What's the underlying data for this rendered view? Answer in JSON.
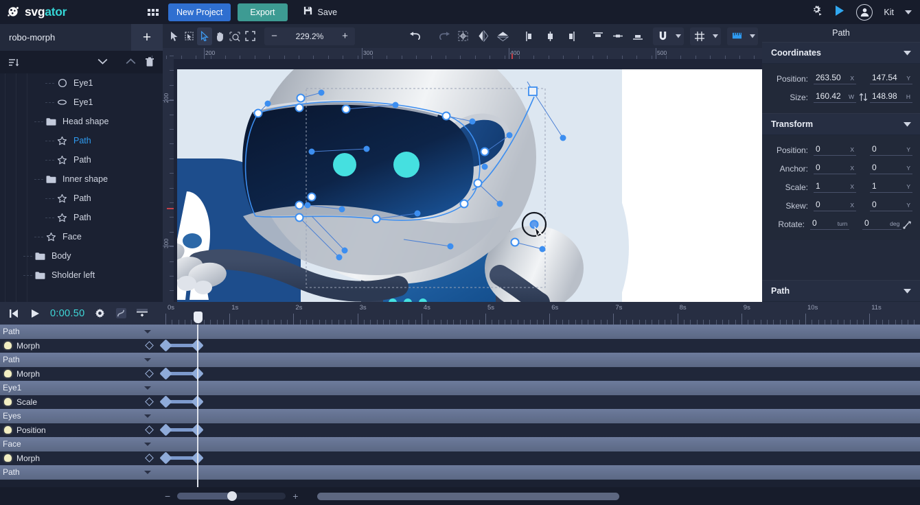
{
  "app": {
    "brand_white": "svg",
    "brand_accent": "ator",
    "accent_color": "#35d6d6"
  },
  "topbar": {
    "apps_icon": "grid-apps-icon",
    "new_project_label": "New Project",
    "export_label": "Export",
    "save_label": "Save",
    "settings_icon": "gear-run-icon",
    "play_icon": "play-icon",
    "user_name": "Kit",
    "user_menu_icon": "chevron-down-icon"
  },
  "left_panel": {
    "project_name": "robo-morph",
    "add_label": "+",
    "tools": {
      "sort_icon": "sort-list-icon",
      "collapse_icon": "chevron-down-icon",
      "expand_icon": "chevron-up-icon",
      "delete_icon": "trash-icon"
    },
    "layers": [
      {
        "label": "Eye1",
        "icon": "circle-shape-icon",
        "depth": 4,
        "type": "shape",
        "selected": false
      },
      {
        "label": "Eye1",
        "icon": "ellipse-shape-icon",
        "depth": 4,
        "type": "shape",
        "selected": false
      },
      {
        "label": "Head shape",
        "icon": "folder-icon",
        "depth": 3,
        "type": "folder",
        "selected": false
      },
      {
        "label": "Path",
        "icon": "path-star-icon",
        "depth": 4,
        "type": "path",
        "selected": true
      },
      {
        "label": "Path",
        "icon": "path-star-icon",
        "depth": 4,
        "type": "path",
        "selected": false
      },
      {
        "label": "Inner shape",
        "icon": "folder-icon",
        "depth": 3,
        "type": "folder",
        "selected": false
      },
      {
        "label": "Path",
        "icon": "path-star-icon",
        "depth": 4,
        "type": "path",
        "selected": false
      },
      {
        "label": "Path",
        "icon": "path-star-icon",
        "depth": 4,
        "type": "path",
        "selected": false
      },
      {
        "label": "Face",
        "icon": "path-star-icon",
        "depth": 3,
        "type": "path",
        "selected": false
      },
      {
        "label": "Body",
        "icon": "folder-icon",
        "depth": 2,
        "type": "folder",
        "selected": false
      },
      {
        "label": "Sholder left",
        "icon": "folder-icon",
        "depth": 2,
        "type": "folder",
        "selected": false
      }
    ]
  },
  "canvas_toolbar": {
    "tools": [
      {
        "name": "select-arrow-tool",
        "active": false
      },
      {
        "name": "transform-box-tool",
        "active": false
      },
      {
        "name": "node-edit-tool",
        "active": true
      },
      {
        "name": "hand-pan-tool",
        "active": false
      },
      {
        "name": "zoom-tool",
        "active": false
      },
      {
        "name": "fit-screen-tool",
        "active": false
      }
    ],
    "zoom_minus": "−",
    "zoom_value": "229.2%",
    "zoom_plus": "+",
    "undo_icon": "undo-arrow-icon",
    "redo_icon": "redo-arrow-icon",
    "align_tools": [
      "anchor-center-icon",
      "flip-horizontal-icon",
      "flip-vertical-icon",
      "align-left-icon",
      "align-center-h-icon",
      "align-right-icon",
      "align-top-icon",
      "align-middle-v-icon",
      "align-bottom-icon"
    ],
    "snap_icon": "magnet-snap-icon",
    "grid_icon": "grid-icon",
    "ruler_icon": "ruler-icon",
    "dropdown_icon": "caret-down-icon"
  },
  "canvas": {
    "ruler_h_labels": [
      "200",
      "300",
      "400",
      "500"
    ],
    "ruler_v_labels": [
      "200",
      "300"
    ],
    "cursor_icon": "pen-node-cursor"
  },
  "right_panel": {
    "title": "Path",
    "sections": [
      {
        "title": "Coordinates",
        "collapse_icon": "caret-down-icon"
      },
      {
        "title": "Transform",
        "collapse_icon": "caret-down-icon"
      },
      {
        "title": "Path",
        "collapse_icon": "caret-down-icon"
      }
    ],
    "coordinates": {
      "position_label": "Position:",
      "position_x": "263.50",
      "position_x_unit": "X",
      "position_y": "147.54",
      "position_y_unit": "Y",
      "size_label": "Size:",
      "size_w": "160.42",
      "size_w_unit": "W",
      "size_h": "148.98",
      "size_h_unit": "H",
      "link_icon": "link-ratio-icon"
    },
    "transform": {
      "rows": [
        {
          "label": "Position:",
          "x": "0",
          "xu": "X",
          "y": "0",
          "yu": "Y"
        },
        {
          "label": "Anchor:",
          "x": "0",
          "xu": "X",
          "y": "0",
          "yu": "Y"
        },
        {
          "label": "Scale:",
          "x": "1",
          "xu": "X",
          "y": "1",
          "yu": "Y"
        },
        {
          "label": "Skew:",
          "x": "0",
          "xu": "X",
          "y": "0",
          "yu": "Y"
        },
        {
          "label": "Rotate:",
          "x": "0",
          "xu": "turn",
          "y": "0",
          "yu": "deg",
          "extra_icon": "rotate-handle-icon"
        }
      ]
    }
  },
  "timeline": {
    "controls": {
      "skip_start_icon": "skip-to-start-icon",
      "play_icon": "play-icon",
      "current_time": "0:00.50",
      "settings_icon": "gear-icon",
      "easing_icon": "easing-curve-icon",
      "keyframe_panel_icon": "keyframe-editor-icon"
    },
    "ruler_labels": [
      "0s",
      "1s",
      "2s",
      "3s",
      "4s",
      "5s",
      "6s",
      "7s",
      "8s",
      "9s",
      "10s",
      "11s"
    ],
    "playhead_time_s": 0.5,
    "tracks": [
      {
        "type": "group",
        "label": "Path",
        "caret_icon": "caret-down-icon"
      },
      {
        "type": "prop",
        "label": "Morph",
        "bulb_icon": "bulb-icon",
        "kf_icon": "keyframe-diamond-icon",
        "keyframes": [
          0,
          0.5
        ]
      },
      {
        "type": "group",
        "label": "Path",
        "caret_icon": "caret-down-icon"
      },
      {
        "type": "prop",
        "label": "Morph",
        "bulb_icon": "bulb-icon",
        "kf_icon": "keyframe-diamond-icon",
        "keyframes": [
          0,
          0.5
        ]
      },
      {
        "type": "group",
        "label": "Eye1",
        "caret_icon": "caret-down-icon"
      },
      {
        "type": "prop",
        "label": "Scale",
        "bulb_icon": "bulb-icon",
        "kf_icon": "keyframe-diamond-icon",
        "keyframes": [
          0,
          0.5
        ]
      },
      {
        "type": "group",
        "label": "Eyes",
        "caret_icon": "caret-down-icon"
      },
      {
        "type": "prop",
        "label": "Position",
        "bulb_icon": "bulb-icon",
        "kf_icon": "keyframe-diamond-icon",
        "keyframes": [
          0,
          0.5
        ]
      },
      {
        "type": "group",
        "label": "Face",
        "caret_icon": "caret-down-icon"
      },
      {
        "type": "prop",
        "label": "Morph",
        "bulb_icon": "bulb-icon",
        "kf_icon": "keyframe-diamond-icon",
        "keyframes": [
          0,
          0.5
        ]
      },
      {
        "type": "group",
        "label": "Path",
        "caret_icon": "caret-down-icon"
      }
    ],
    "footer": {
      "zoom_out": "−",
      "zoom_in": "+",
      "zoom_value_pct": 46
    }
  }
}
